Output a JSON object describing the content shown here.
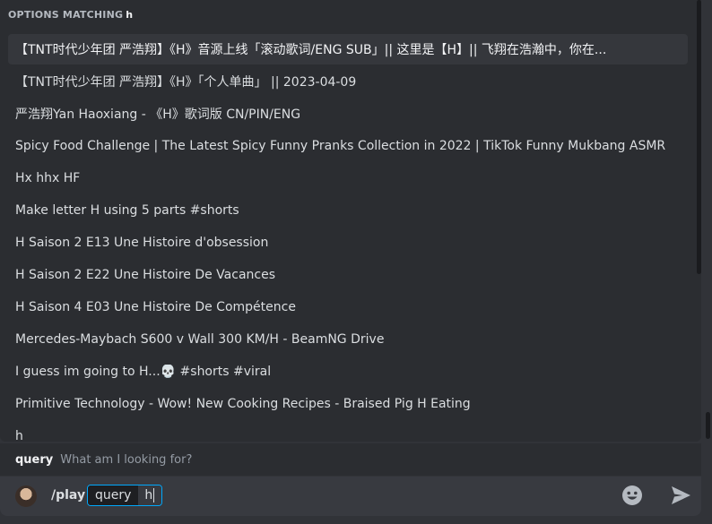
{
  "popup": {
    "header_prefix": "OPTIONS MATCHING",
    "header_query": "h",
    "options": [
      "【TNT时代少年团 严浩翔】《H》音源上线「滚动歌词/ENG SUB」|| 这里是【H】|| 飞翔在浩瀚中，你在...",
      "【TNT时代少年团 严浩翔】《H》「个人单曲」 || 2023-04-09",
      "严浩翔Yan Haoxiang  - 《H》歌词版 CN/PIN/ENG",
      "Spicy Food Challenge | The Latest Spicy Funny Pranks Collection in 2022 | TikTok Funny Mukbang ASMR",
      "Hx hhx HF",
      "Make letter H using 5 parts #shorts",
      "H Saison 2 E13 Une Histoire d'obsession",
      "H Saison 2 E22 Une Histoire De Vacances",
      "H Saison 4 E03 Une Histoire De Compétence",
      "Mercedes-Maybach S600 v Wall 300 KM/H - BeamNG Drive",
      "I guess im going to H...💀 #shorts #viral",
      "Primitive Technology - Wow! New Cooking Recipes - Braised Pig H Eating",
      "h"
    ]
  },
  "param_hint": {
    "name": "query",
    "description": "What am I looking for?"
  },
  "composer": {
    "command": "/play",
    "option_name": "query",
    "option_value": "h"
  },
  "icons": {
    "emoji": "emoji-icon",
    "send": "send-icon"
  },
  "colors": {
    "background": "#313338",
    "popup_bg": "#2b2d31",
    "selected_bg": "#35373c",
    "accent_border": "#00a8fc",
    "send_icon": "#b5bac1"
  }
}
